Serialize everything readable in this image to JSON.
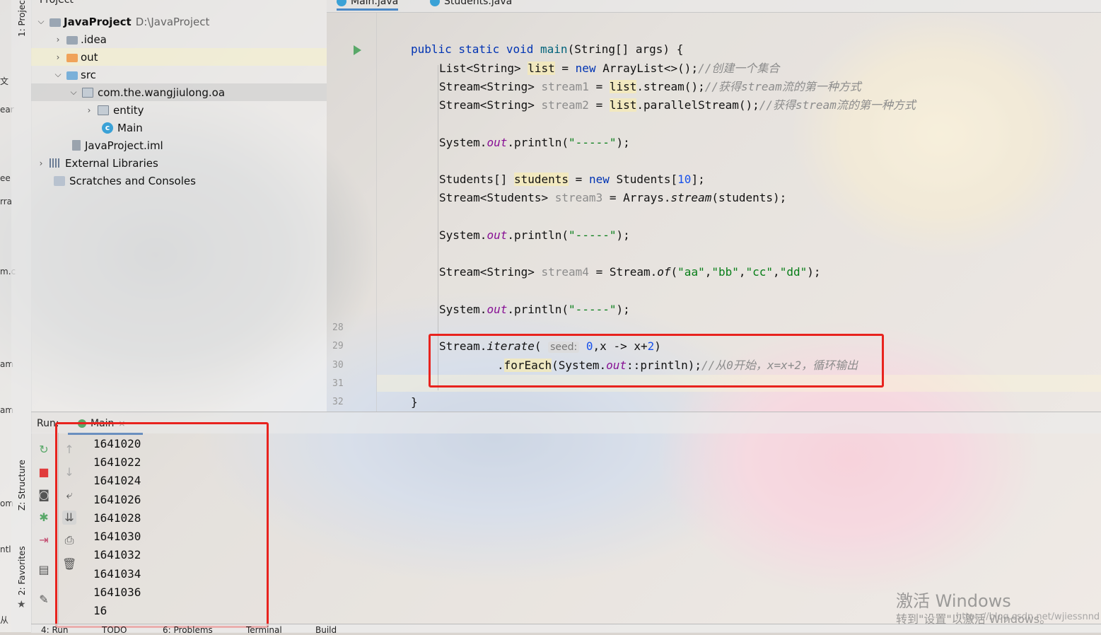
{
  "project": {
    "header": "Project",
    "tree": [
      {
        "label": "JavaProject",
        "path": "D:\\JavaProject",
        "icon": "folder-grey"
      },
      {
        "label": ".idea",
        "icon": "folder-grey"
      },
      {
        "label": "out",
        "icon": "folder-orange"
      },
      {
        "label": "src",
        "icon": "folder-blue"
      },
      {
        "label": "com.the.wangjiulong.oa",
        "icon": "package"
      },
      {
        "label": "entity",
        "icon": "package"
      },
      {
        "label": "Main",
        "icon": "class"
      },
      {
        "label": "JavaProject.iml",
        "icon": "iml-file"
      },
      {
        "label": "External Libraries",
        "icon": "libraries"
      },
      {
        "label": "Scratches and Consoles",
        "icon": "scratches"
      }
    ]
  },
  "editor": {
    "tabs": [
      {
        "label": "Main.java"
      },
      {
        "label": "Students.java"
      }
    ],
    "line_numbers": [
      "28",
      "29",
      "30",
      "31",
      "32"
    ],
    "inlay_hint": "seed:"
  },
  "left_strip": {
    "project_tab": "1: Project",
    "structure_tab": "Z: Structure",
    "favorites_tab": "2: Favorites"
  },
  "edge_fragments": [
    "文",
    "ear",
    "ee",
    "rra",
    "m.c",
    "am",
    "am",
    "om",
    "ntl",
    "从"
  ],
  "run": {
    "label": "Run:",
    "tab": "Main",
    "output": [
      "1641020",
      "1641022",
      "1641024",
      "1641026",
      "1641028",
      "1641030",
      "1641032",
      "1641034",
      "1641036",
      "16"
    ]
  },
  "bottom_tabs": [
    "4: Run",
    "TODO",
    "6: Problems",
    "Terminal",
    "Build"
  ],
  "watermark": {
    "line1": "激活 Windows",
    "line2": "转到\"设置\"以激活 Windows。",
    "csdn": "https://blog.csdn.net/wjiessnnd"
  },
  "colors": {
    "highlight_box": "#e8231e",
    "keyword": "#0033b3",
    "string": "#067d17",
    "comment": "#8c8c8c"
  }
}
